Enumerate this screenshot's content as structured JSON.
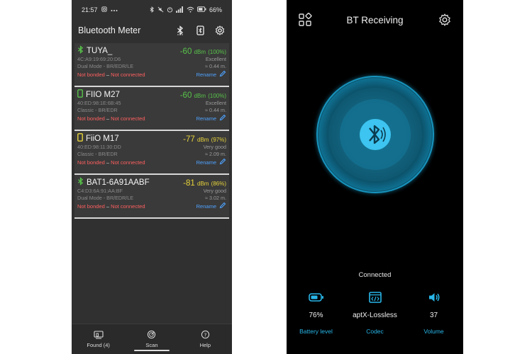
{
  "left_phone": {
    "status_bar": {
      "time": "21:57",
      "battery": "66%"
    },
    "header": {
      "title": "Bluetooth Meter"
    },
    "devices": [
      {
        "name": "TUYA_",
        "icon": "bluetooth-icon",
        "signal_dbm": "-60",
        "signal_unit": "dBm",
        "signal_pct": "(100%)",
        "signal_color": "#58c34a",
        "mac": "4C:A9:19:69:20:D6",
        "quality": "Excellent",
        "mode": "Dual Mode - BR/EDR/LE",
        "distance": "≈ 0.44 m.",
        "bond_status": "Not bonded",
        "separator": "–",
        "conn_status": "Not connected",
        "rename": "Rename"
      },
      {
        "name": "FIIO M27",
        "icon": "phone-icon",
        "signal_dbm": "-60",
        "signal_unit": "dBm",
        "signal_pct": "(100%)",
        "signal_color": "#58c34a",
        "mac": "40:ED:98:1E:6B:45",
        "quality": "Excellent",
        "mode": "Classic - BR/EDR",
        "distance": "≈ 0.44 m.",
        "bond_status": "Not bonded",
        "separator": "–",
        "conn_status": "Not connected",
        "rename": "Rename"
      },
      {
        "name": "FiiO M17",
        "icon": "phone-icon",
        "signal_dbm": "-77",
        "signal_unit": "dBm",
        "signal_pct": "(97%)",
        "signal_color": "#e7d33a",
        "mac": "40:ED:98:11:30:DD",
        "quality": "Very good",
        "mode": "Classic - BR/EDR",
        "distance": "≈ 2.09 m.",
        "bond_status": "Not bonded",
        "separator": "–",
        "conn_status": "Not connected",
        "rename": "Rename"
      },
      {
        "name": "BAT1-6A91AABF",
        "icon": "bluetooth-icon",
        "signal_dbm": "-81",
        "signal_unit": "dBm",
        "signal_pct": "(86%)",
        "signal_color": "#e7d33a",
        "mac": "C4:D3:6A:91:AA:BF",
        "quality": "Very good",
        "mode": "Dual Mode - BR/EDR/LE",
        "distance": "≈ 3.02 m.",
        "bond_status": "Not bonded",
        "separator": "–",
        "conn_status": "Not connected",
        "rename": "Rename"
      }
    ],
    "bottom_nav": [
      {
        "label": "Found (4)",
        "icon": "devices-icon"
      },
      {
        "label": "Scan",
        "icon": "scan-icon"
      },
      {
        "label": "Help",
        "icon": "help-icon"
      }
    ]
  },
  "right_phone": {
    "header": {
      "title": "BT Receiving"
    },
    "connected": "Connected",
    "stats": [
      {
        "value": "76%",
        "label": "Battery level",
        "icon": "battery-icon"
      },
      {
        "value": "aptX-Lossless",
        "label": "Codec",
        "icon": "codec-icon"
      },
      {
        "value": "37",
        "label": "Volume",
        "icon": "volume-icon"
      }
    ],
    "accent_color": "#28b6e8"
  }
}
